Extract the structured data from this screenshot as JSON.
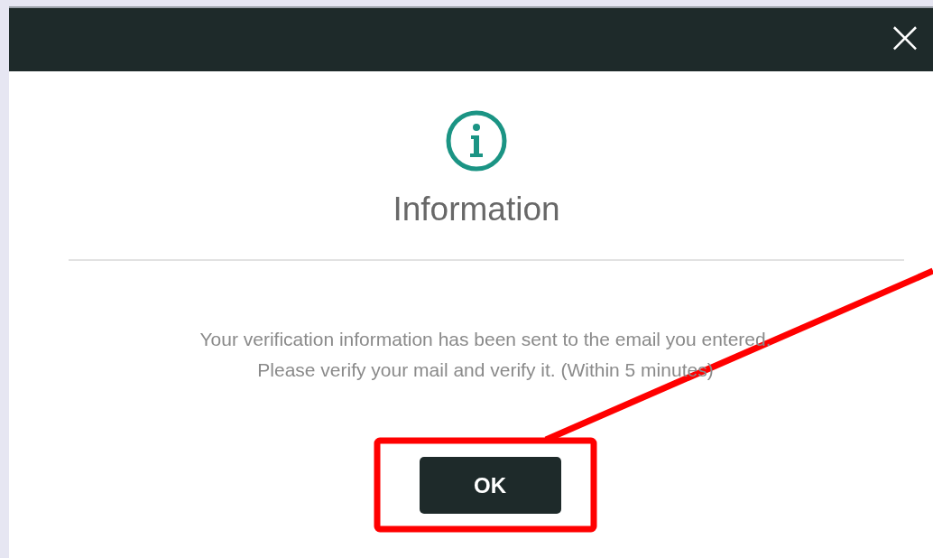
{
  "dialog": {
    "close_label": "×",
    "title": "Information",
    "message_lines": [
      "Your verification information has been sent to the email you entered.",
      "Please verify your mail and verify it. (Within 5 minutes)"
    ],
    "buttons": [
      "OK"
    ]
  }
}
